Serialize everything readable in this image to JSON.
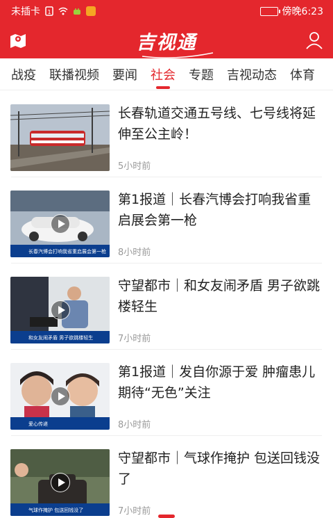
{
  "status_bar": {
    "carrier": "未插卡",
    "time": "傍晚6:23",
    "icons": [
      "sim-icon",
      "wifi-icon",
      "android-icon",
      "app-icon"
    ]
  },
  "app_bar": {
    "logo_text": "吉视通",
    "left_icon": "map-location-icon",
    "right_icon": "user-icon"
  },
  "tabs": [
    {
      "label": "战疫",
      "active": false
    },
    {
      "label": "联播视频",
      "active": false
    },
    {
      "label": "要闻",
      "active": false
    },
    {
      "label": "社会",
      "active": true
    },
    {
      "label": "专题",
      "active": false
    },
    {
      "label": "吉视动态",
      "active": false
    },
    {
      "label": "体育",
      "active": false
    }
  ],
  "news": [
    {
      "title": "长春轨道交通五号线、七号线将延伸至公主岭！",
      "time": "5小时前",
      "video": false,
      "caption": ""
    },
    {
      "title": "第1报道｜长春汽博会打响我省重启展会第一枪",
      "time": "8小时前",
      "video": true,
      "caption": "长春汽博会打响我省重启展会第一枪"
    },
    {
      "title": "守望都市｜和女友闹矛盾 男子欲跳楼轻生",
      "time": "7小时前",
      "video": true,
      "caption": "和女友闹矛盾 男子欲跳楼轻生"
    },
    {
      "title": "第1报道｜发自你源于爱 肿瘤患儿期待“无色”关注",
      "time": "8小时前",
      "video": true,
      "caption": "爱心传递"
    },
    {
      "title": "守望都市｜气球作掩护 包送回钱没了",
      "time": "7小时前",
      "video": true,
      "caption": "气球作掩护 包送回钱没了"
    }
  ],
  "colors": {
    "brand_red": "#e4272d",
    "caption_blue": "#0b3e8e",
    "time_gray": "#999999"
  }
}
